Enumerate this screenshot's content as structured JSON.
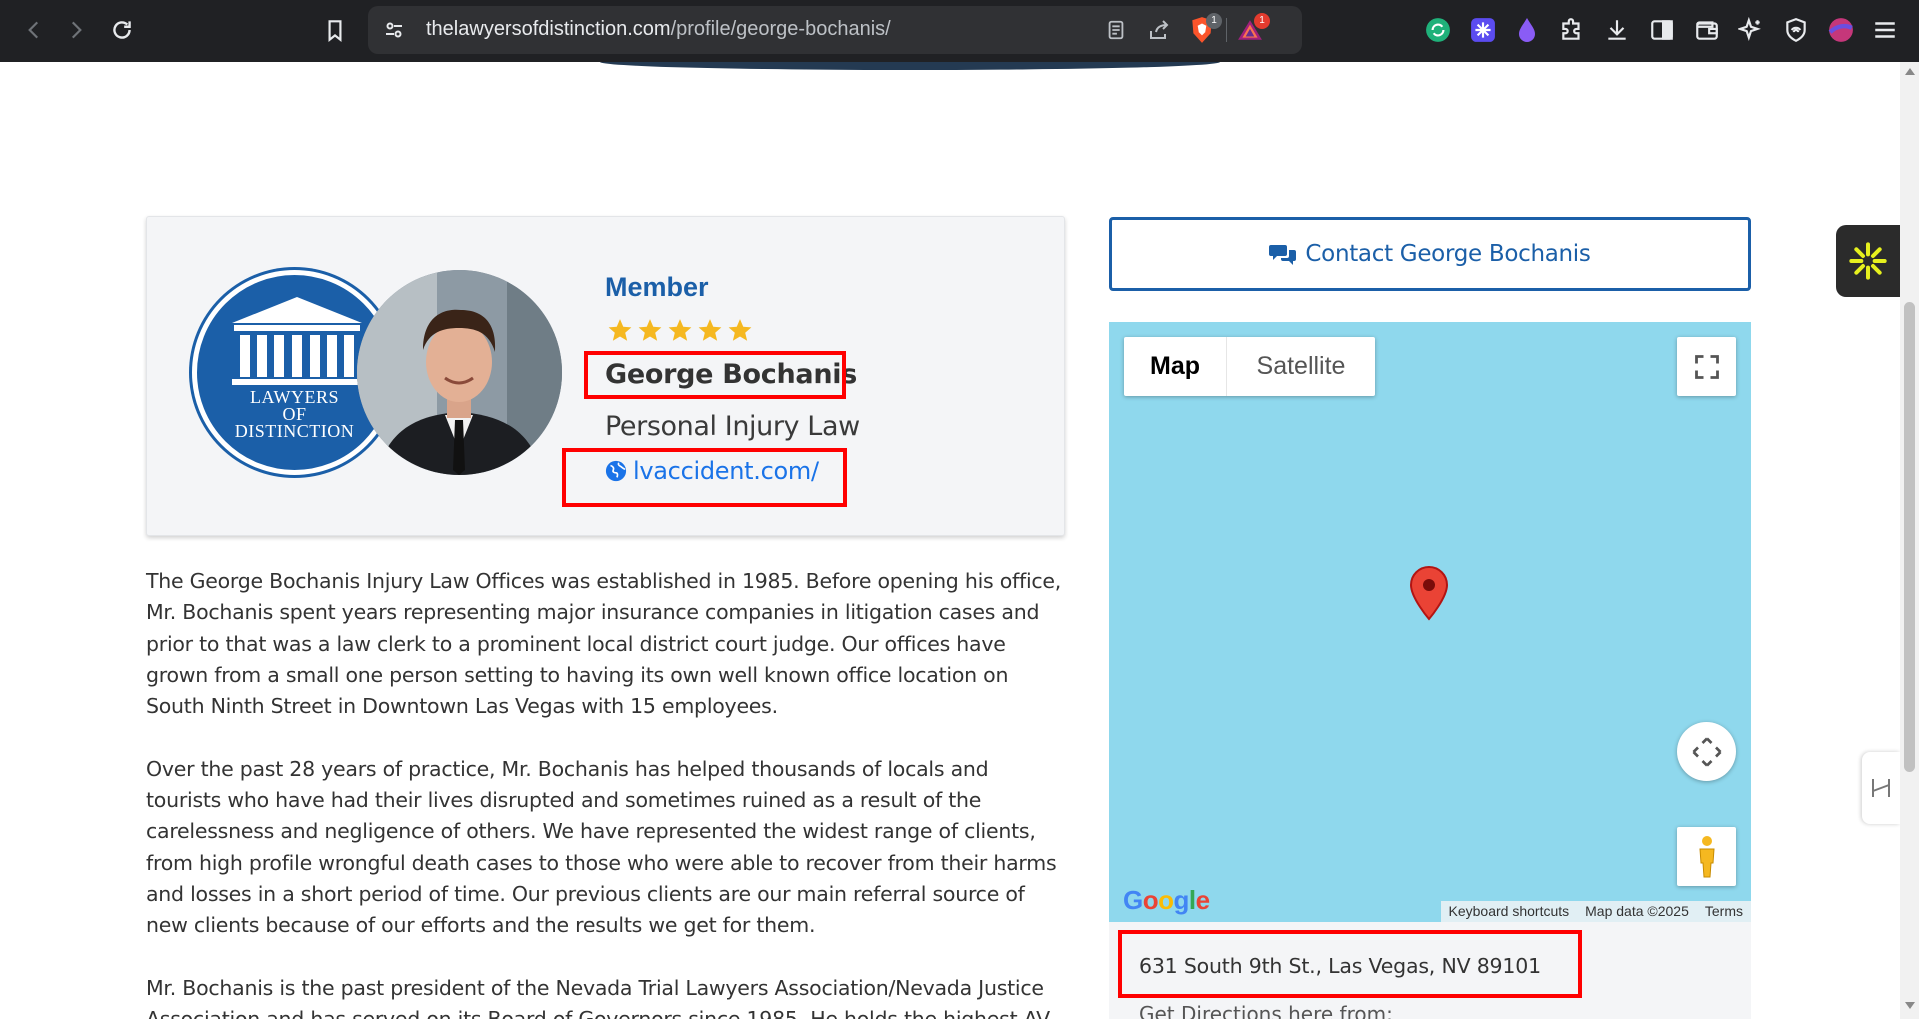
{
  "browser": {
    "url_domain": "thelawyersofdistinction.com",
    "url_path": "/profile/george-bochanis/",
    "badge_brave": "1",
    "badge_rewards": "1"
  },
  "profile": {
    "logo_lines": [
      "LAWYERS",
      "OF",
      "DISTINCTION"
    ],
    "member_label": "Member",
    "rating_stars": 5,
    "name": "George Bochanis",
    "practice_area": "Personal Injury Law",
    "website": "lvaccident.com/"
  },
  "bio": {
    "paragraphs": [
      "The George Bochanis Injury Law Offices was established in 1985. Before opening his office, Mr. Bochanis spent years representing major insurance companies in litigation cases and prior to that was a law clerk to a prominent local district court judge. Our offices have grown from a small one person setting to having its own well known office location on South Ninth Street in Downtown Las Vegas with 15 employees.",
      "Over the past 28 years of practice, Mr. Bochanis has helped thousands of locals and tourists who have had their lives disrupted and sometimes ruined as a result of the carelessness and negligence of others. We have represented the widest range of clients, from high profile wrongful death cases to those who were able to recover from their harms and losses in a short period of time. Our previous clients are our main referral source of new clients because of our efforts and the results we get for them.",
      "Mr. Bochanis is the past president of the Nevada Trial Lawyers Association/Nevada Justice Association and has served on its Board of Governors since 1985. He holds the highest AV"
    ]
  },
  "contact": {
    "button_label": "Contact George Bochanis"
  },
  "map": {
    "type_map": "Map",
    "type_satellite": "Satellite",
    "google_logo": "Google",
    "keyboard_shortcuts": "Keyboard shortcuts",
    "map_data": "Map data ©2025",
    "terms": "Terms",
    "address": "631 South 9th St., Las Vegas, NV 89101",
    "directions_label": "Get Directions here from:"
  },
  "colors": {
    "brand_blue": "#1b5fa8",
    "link_blue": "#1a73e8",
    "star_gold": "#f5b820",
    "highlight_red": "#ff0000",
    "map_water": "#8fd8ed"
  }
}
